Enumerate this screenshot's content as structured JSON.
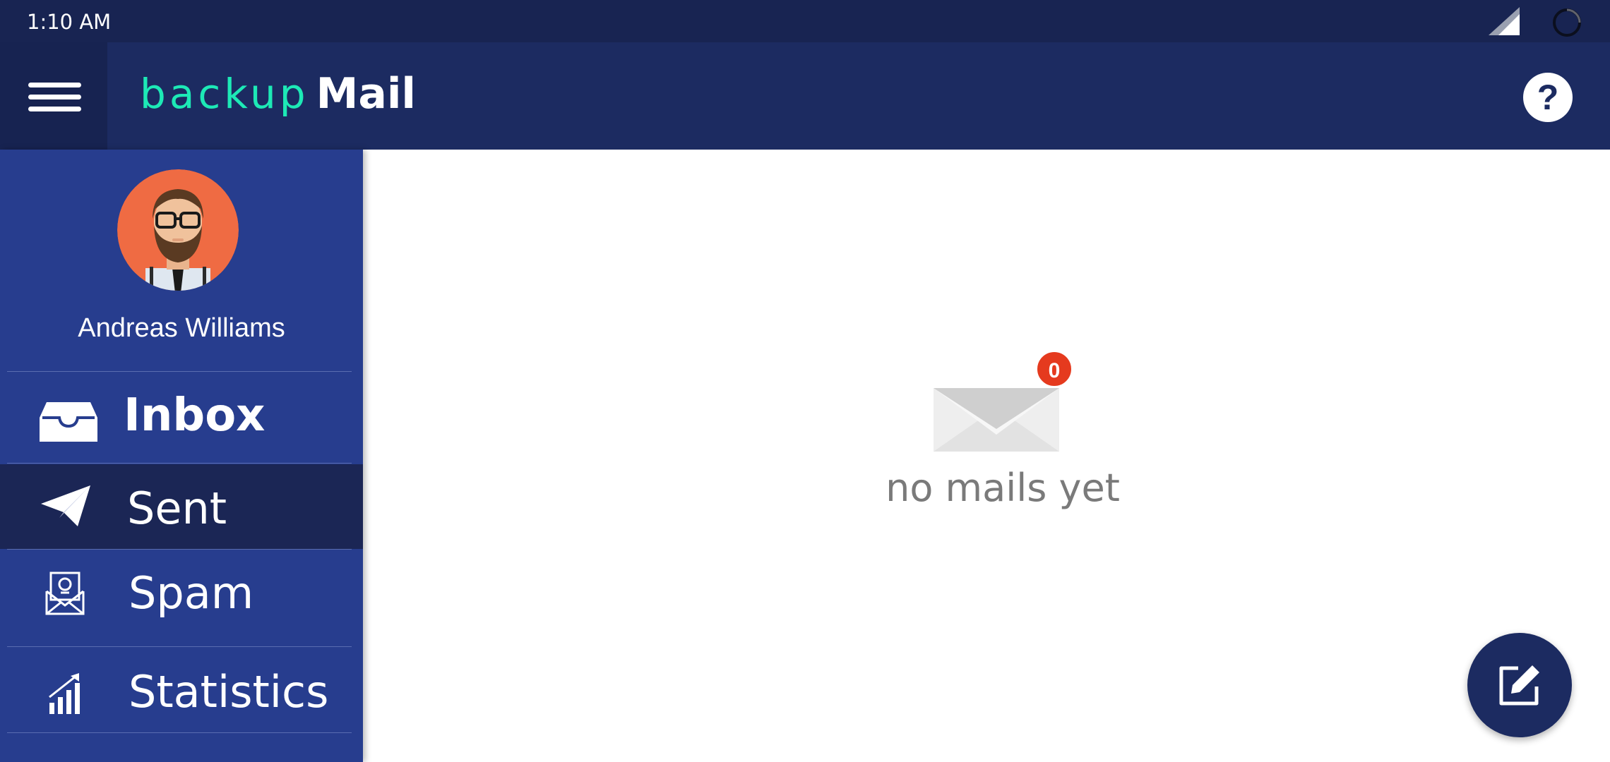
{
  "status_bar": {
    "time": "1:10 AM"
  },
  "app_bar": {
    "brand_prefix": "backup",
    "brand_suffix": "Mail",
    "help_label": "?"
  },
  "sidebar": {
    "user_name": "Andreas Williams",
    "items": [
      {
        "label": "Inbox",
        "icon": "inbox-tray-icon"
      },
      {
        "label": "Sent",
        "icon": "paper-plane-icon",
        "active": true
      },
      {
        "label": "Spam",
        "icon": "spam-mail-icon"
      },
      {
        "label": "Statistics",
        "icon": "statistics-icon"
      }
    ]
  },
  "main": {
    "empty_badge": "0",
    "empty_message": "no mails yet"
  },
  "colors": {
    "status_bar": "#182452",
    "app_bar": "#1c2b61",
    "sidebar": "#273d8e",
    "active_item": "#1b2655",
    "brand_accent": "#1de9b6",
    "badge": "#e53a1e",
    "avatar_bg": "#ef6b43"
  }
}
